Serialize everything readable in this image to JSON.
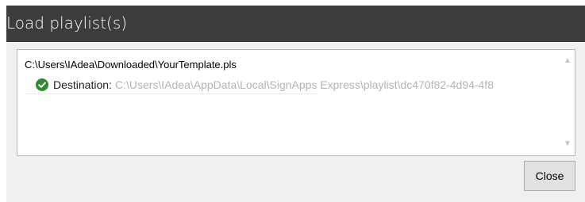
{
  "dialog": {
    "title": "Load playlist(s)"
  },
  "list": {
    "items": [
      {
        "path": "C:\\Users\\IAdea\\Downloaded\\YourTemplate.pls",
        "destination_label": "Destination:",
        "destination_value": "C:\\Users\\IAdea\\AppData\\Local\\SignApps Express\\playlist\\dc470f82-4d94-4f8",
        "status_icon": "check-circle-icon",
        "status_color": "#2e8b2e"
      }
    ]
  },
  "buttons": {
    "close_label": "Close"
  }
}
